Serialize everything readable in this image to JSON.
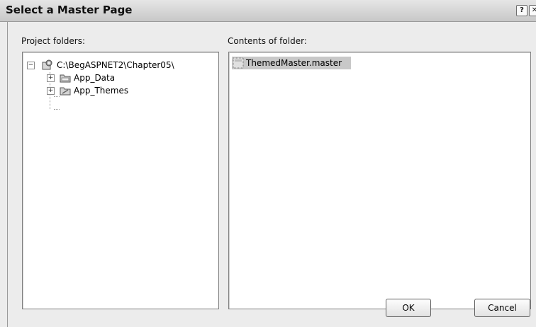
{
  "window": {
    "title": "Select a Master Page",
    "help_glyph": "?",
    "close_glyph": "✕"
  },
  "left": {
    "label": "Project folders:",
    "tree": [
      {
        "text": "C:\\BegASPNET2\\Chapter05\\",
        "icon": "project-icon",
        "expanded": true
      },
      {
        "text": "App_Data",
        "icon": "folder-icon",
        "expanded": false
      },
      {
        "text": "App_Themes",
        "icon": "folder-icon",
        "expanded": false
      }
    ]
  },
  "right": {
    "label": "Contents of folder:",
    "files": [
      {
        "text": "ThemedMaster.master",
        "icon": "master-page-icon",
        "selected": true
      }
    ]
  },
  "buttons": {
    "ok": "OK",
    "cancel": "Cancel"
  },
  "glyphs": {
    "expanded": "−",
    "collapsed": "+"
  }
}
